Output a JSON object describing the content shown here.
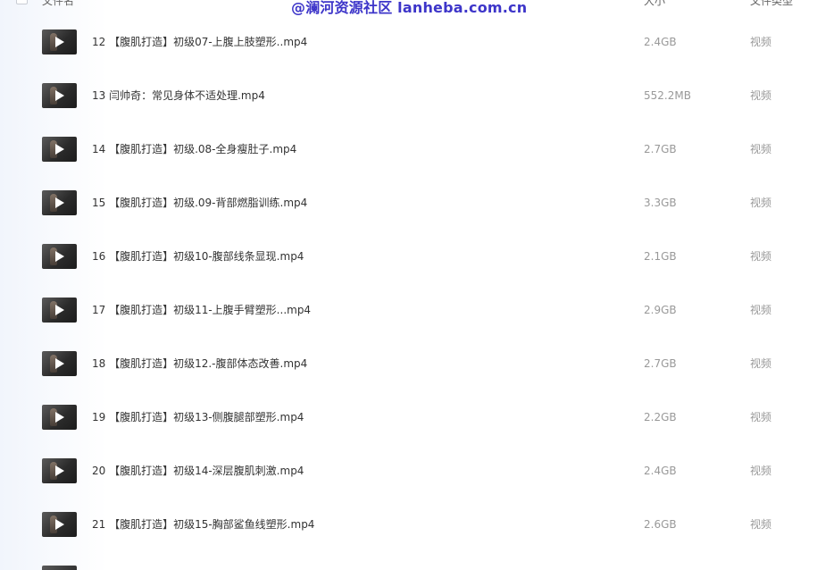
{
  "header": {
    "name_label": "文件名",
    "size_label": "大小",
    "type_label": "文件类型"
  },
  "watermark": "@澜河资源社区 lanheba.com.cn",
  "files": [
    {
      "name": "12 【腹肌打造】初级07-上腹上肢塑形..mp4",
      "size": "2.4GB",
      "type": "视频"
    },
    {
      "name": "13 闫帅奇：常见身体不适处理.mp4",
      "size": "552.2MB",
      "type": "视频"
    },
    {
      "name": "14 【腹肌打造】初级.08-全身瘦肚子.mp4",
      "size": "2.7GB",
      "type": "视频"
    },
    {
      "name": "15 【腹肌打造】初级.09-背部燃脂训练.mp4",
      "size": "3.3GB",
      "type": "视频"
    },
    {
      "name": "16 【腹肌打造】初级10-腹部线条显现.mp4",
      "size": "2.1GB",
      "type": "视频"
    },
    {
      "name": "17 【腹肌打造】初级11-上腹手臂塑形...mp4",
      "size": "2.9GB",
      "type": "视频"
    },
    {
      "name": "18 【腹肌打造】初级12.-腹部体态改善.mp4",
      "size": "2.7GB",
      "type": "视频"
    },
    {
      "name": "19 【腹肌打造】初级13-侧腹腿部塑形.mp4",
      "size": "2.2GB",
      "type": "视频"
    },
    {
      "name": "20 【腹肌打造】初级14-深层腹肌刺激.mp4",
      "size": "2.4GB",
      "type": "视频"
    },
    {
      "name": "21 【腹肌打造】初级15-胸部鲨鱼线塑形.mp4",
      "size": "2.6GB",
      "type": "视频"
    }
  ]
}
